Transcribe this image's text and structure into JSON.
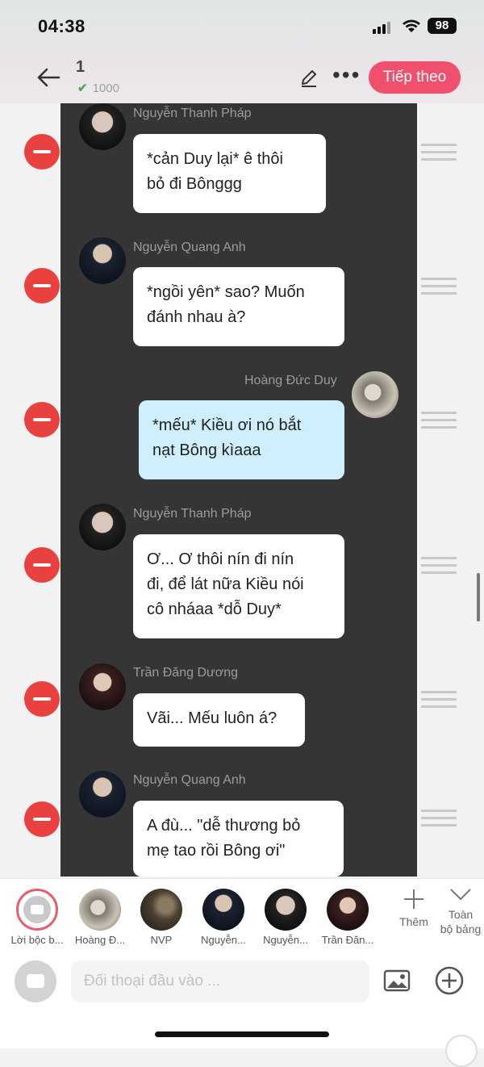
{
  "status_bar": {
    "time": "04:38",
    "battery": "98"
  },
  "header": {
    "title": "1",
    "subtitle": "1000",
    "next_label": "Tiếp theo"
  },
  "messages": [
    {
      "speaker": "Nguyễn Thanh Pháp",
      "text": "*cản Duy lại* ê thôi\nbỏ đi Bônggg",
      "side": "left"
    },
    {
      "speaker": "Nguyễn Quang Anh",
      "text": "*ngồi yên* sao? Muốn\nđánh nhau à?",
      "side": "left"
    },
    {
      "speaker": "Hoàng Đức Duy",
      "text": "*mếu* Kiều ơi nó bắt\nnạt Bông kìaaa",
      "side": "right"
    },
    {
      "speaker": "Nguyễn Thanh Pháp",
      "text": "Ơ... Ơ thôi nín đi nín\nđi, để lát nữa Kiều nói\ncô nháaa *dỗ Duy*",
      "side": "left"
    },
    {
      "speaker": "Trần Đăng Dương",
      "text": "Vãi... Mếu luôn á?",
      "side": "left"
    },
    {
      "speaker": "Nguyễn Quang Anh",
      "text": "A đù... \"dễ thương bỏ\nmẹ tao rồi Bông ơi\"",
      "side": "left"
    }
  ],
  "cast": [
    {
      "label": "Lời bộc b..."
    },
    {
      "label": "Hoàng Đ..."
    },
    {
      "label": "NVP"
    },
    {
      "label": "Nguyễn..."
    },
    {
      "label": "Nguyễn..."
    },
    {
      "label": "Trần Đăn..."
    }
  ],
  "cast_actions": {
    "add_label": "Thêm",
    "collapse_label": "Toàn\nbộ bảng"
  },
  "input": {
    "placeholder": "Đối thoại đầu vào ..."
  },
  "colors": {
    "accent": "#f0506e",
    "delete": "#e8413f",
    "chat_bg": "#353535",
    "my_bubble": "#cfefff"
  }
}
